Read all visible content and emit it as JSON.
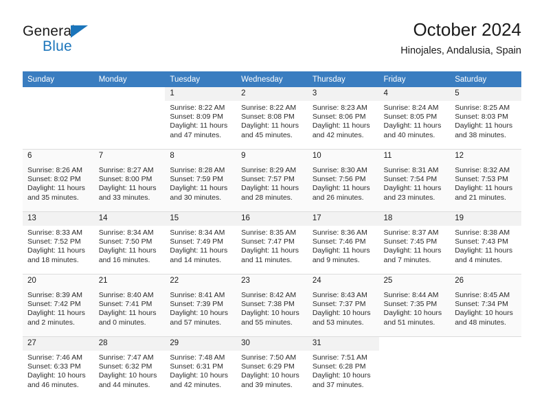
{
  "brand": {
    "name_top": "General",
    "name_bottom": "Blue",
    "triangle_color": "#1b75bb",
    "text_color": "#1a1a1a"
  },
  "header": {
    "title": "October 2024",
    "location": "Hinojales, Andalusia, Spain"
  },
  "theme": {
    "header_row_bg": "#3a7dc0",
    "header_row_text": "#ffffff",
    "daynum_bg": "#f2f2f2",
    "alt_row_bg": "#fafafa",
    "grid_line": "#dcdcdc"
  },
  "weekdays": [
    "Sunday",
    "Monday",
    "Tuesday",
    "Wednesday",
    "Thursday",
    "Friday",
    "Saturday"
  ],
  "weeks": [
    [
      {
        "day": "",
        "lines": []
      },
      {
        "day": "",
        "lines": []
      },
      {
        "day": "1",
        "lines": [
          "Sunrise: 8:22 AM",
          "Sunset: 8:09 PM",
          "Daylight: 11 hours",
          "and 47 minutes."
        ]
      },
      {
        "day": "2",
        "lines": [
          "Sunrise: 8:22 AM",
          "Sunset: 8:08 PM",
          "Daylight: 11 hours",
          "and 45 minutes."
        ]
      },
      {
        "day": "3",
        "lines": [
          "Sunrise: 8:23 AM",
          "Sunset: 8:06 PM",
          "Daylight: 11 hours",
          "and 42 minutes."
        ]
      },
      {
        "day": "4",
        "lines": [
          "Sunrise: 8:24 AM",
          "Sunset: 8:05 PM",
          "Daylight: 11 hours",
          "and 40 minutes."
        ]
      },
      {
        "day": "5",
        "lines": [
          "Sunrise: 8:25 AM",
          "Sunset: 8:03 PM",
          "Daylight: 11 hours",
          "and 38 minutes."
        ]
      }
    ],
    [
      {
        "day": "6",
        "lines": [
          "Sunrise: 8:26 AM",
          "Sunset: 8:02 PM",
          "Daylight: 11 hours",
          "and 35 minutes."
        ]
      },
      {
        "day": "7",
        "lines": [
          "Sunrise: 8:27 AM",
          "Sunset: 8:00 PM",
          "Daylight: 11 hours",
          "and 33 minutes."
        ]
      },
      {
        "day": "8",
        "lines": [
          "Sunrise: 8:28 AM",
          "Sunset: 7:59 PM",
          "Daylight: 11 hours",
          "and 30 minutes."
        ]
      },
      {
        "day": "9",
        "lines": [
          "Sunrise: 8:29 AM",
          "Sunset: 7:57 PM",
          "Daylight: 11 hours",
          "and 28 minutes."
        ]
      },
      {
        "day": "10",
        "lines": [
          "Sunrise: 8:30 AM",
          "Sunset: 7:56 PM",
          "Daylight: 11 hours",
          "and 26 minutes."
        ]
      },
      {
        "day": "11",
        "lines": [
          "Sunrise: 8:31 AM",
          "Sunset: 7:54 PM",
          "Daylight: 11 hours",
          "and 23 minutes."
        ]
      },
      {
        "day": "12",
        "lines": [
          "Sunrise: 8:32 AM",
          "Sunset: 7:53 PM",
          "Daylight: 11 hours",
          "and 21 minutes."
        ]
      }
    ],
    [
      {
        "day": "13",
        "lines": [
          "Sunrise: 8:33 AM",
          "Sunset: 7:52 PM",
          "Daylight: 11 hours",
          "and 18 minutes."
        ]
      },
      {
        "day": "14",
        "lines": [
          "Sunrise: 8:34 AM",
          "Sunset: 7:50 PM",
          "Daylight: 11 hours",
          "and 16 minutes."
        ]
      },
      {
        "day": "15",
        "lines": [
          "Sunrise: 8:34 AM",
          "Sunset: 7:49 PM",
          "Daylight: 11 hours",
          "and 14 minutes."
        ]
      },
      {
        "day": "16",
        "lines": [
          "Sunrise: 8:35 AM",
          "Sunset: 7:47 PM",
          "Daylight: 11 hours",
          "and 11 minutes."
        ]
      },
      {
        "day": "17",
        "lines": [
          "Sunrise: 8:36 AM",
          "Sunset: 7:46 PM",
          "Daylight: 11 hours",
          "and 9 minutes."
        ]
      },
      {
        "day": "18",
        "lines": [
          "Sunrise: 8:37 AM",
          "Sunset: 7:45 PM",
          "Daylight: 11 hours",
          "and 7 minutes."
        ]
      },
      {
        "day": "19",
        "lines": [
          "Sunrise: 8:38 AM",
          "Sunset: 7:43 PM",
          "Daylight: 11 hours",
          "and 4 minutes."
        ]
      }
    ],
    [
      {
        "day": "20",
        "lines": [
          "Sunrise: 8:39 AM",
          "Sunset: 7:42 PM",
          "Daylight: 11 hours",
          "and 2 minutes."
        ]
      },
      {
        "day": "21",
        "lines": [
          "Sunrise: 8:40 AM",
          "Sunset: 7:41 PM",
          "Daylight: 11 hours",
          "and 0 minutes."
        ]
      },
      {
        "day": "22",
        "lines": [
          "Sunrise: 8:41 AM",
          "Sunset: 7:39 PM",
          "Daylight: 10 hours",
          "and 57 minutes."
        ]
      },
      {
        "day": "23",
        "lines": [
          "Sunrise: 8:42 AM",
          "Sunset: 7:38 PM",
          "Daylight: 10 hours",
          "and 55 minutes."
        ]
      },
      {
        "day": "24",
        "lines": [
          "Sunrise: 8:43 AM",
          "Sunset: 7:37 PM",
          "Daylight: 10 hours",
          "and 53 minutes."
        ]
      },
      {
        "day": "25",
        "lines": [
          "Sunrise: 8:44 AM",
          "Sunset: 7:35 PM",
          "Daylight: 10 hours",
          "and 51 minutes."
        ]
      },
      {
        "day": "26",
        "lines": [
          "Sunrise: 8:45 AM",
          "Sunset: 7:34 PM",
          "Daylight: 10 hours",
          "and 48 minutes."
        ]
      }
    ],
    [
      {
        "day": "27",
        "lines": [
          "Sunrise: 7:46 AM",
          "Sunset: 6:33 PM",
          "Daylight: 10 hours",
          "and 46 minutes."
        ]
      },
      {
        "day": "28",
        "lines": [
          "Sunrise: 7:47 AM",
          "Sunset: 6:32 PM",
          "Daylight: 10 hours",
          "and 44 minutes."
        ]
      },
      {
        "day": "29",
        "lines": [
          "Sunrise: 7:48 AM",
          "Sunset: 6:31 PM",
          "Daylight: 10 hours",
          "and 42 minutes."
        ]
      },
      {
        "day": "30",
        "lines": [
          "Sunrise: 7:50 AM",
          "Sunset: 6:29 PM",
          "Daylight: 10 hours",
          "and 39 minutes."
        ]
      },
      {
        "day": "31",
        "lines": [
          "Sunrise: 7:51 AM",
          "Sunset: 6:28 PM",
          "Daylight: 10 hours",
          "and 37 minutes."
        ]
      },
      {
        "day": "",
        "lines": []
      },
      {
        "day": "",
        "lines": []
      }
    ]
  ]
}
